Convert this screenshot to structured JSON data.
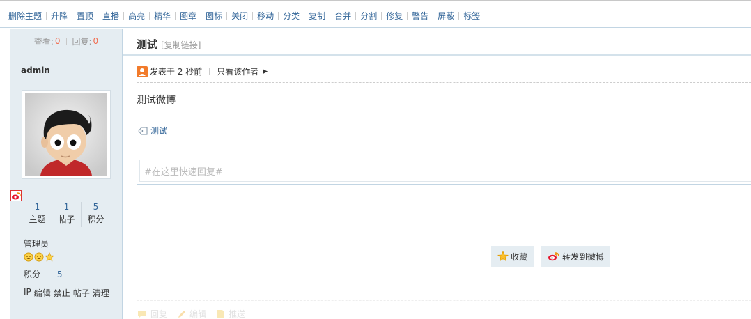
{
  "moderation": {
    "items": [
      "删除主题",
      "升降",
      "置顶",
      "直播",
      "高亮",
      "精华",
      "图章",
      "图标",
      "关闭",
      "移动",
      "分类",
      "复制",
      "合并",
      "分割",
      "修复",
      "警告",
      "屏蔽",
      "标签"
    ]
  },
  "sidebar": {
    "views_label": "查看:",
    "views": "0",
    "replies_label": "回复:",
    "replies": "0",
    "author": "admin",
    "stats": [
      {
        "value": "1",
        "label": "主题"
      },
      {
        "value": "1",
        "label": "帖子"
      },
      {
        "value": "5",
        "label": "积分"
      }
    ],
    "group": "管理员",
    "points_label": "积分",
    "points": "5",
    "admin_links": [
      "IP",
      "编辑",
      "禁止",
      "帖子",
      "清理"
    ]
  },
  "post": {
    "title": "测试",
    "copy_link": "[复制链接]",
    "posted": "发表于 2 秒前",
    "only_author": "只看该作者",
    "content": "测试微博",
    "tag": "测试",
    "reply_placeholder": "#在这里快速回复#",
    "favorite": "收藏",
    "share_weibo": "转发到微博",
    "bottom": [
      "回复",
      "编辑",
      "推送"
    ]
  },
  "colors": {
    "link": "#336699",
    "count": "#f26c4f",
    "sidebar_bg": "#e5edf2",
    "border": "#c2d5e3"
  }
}
